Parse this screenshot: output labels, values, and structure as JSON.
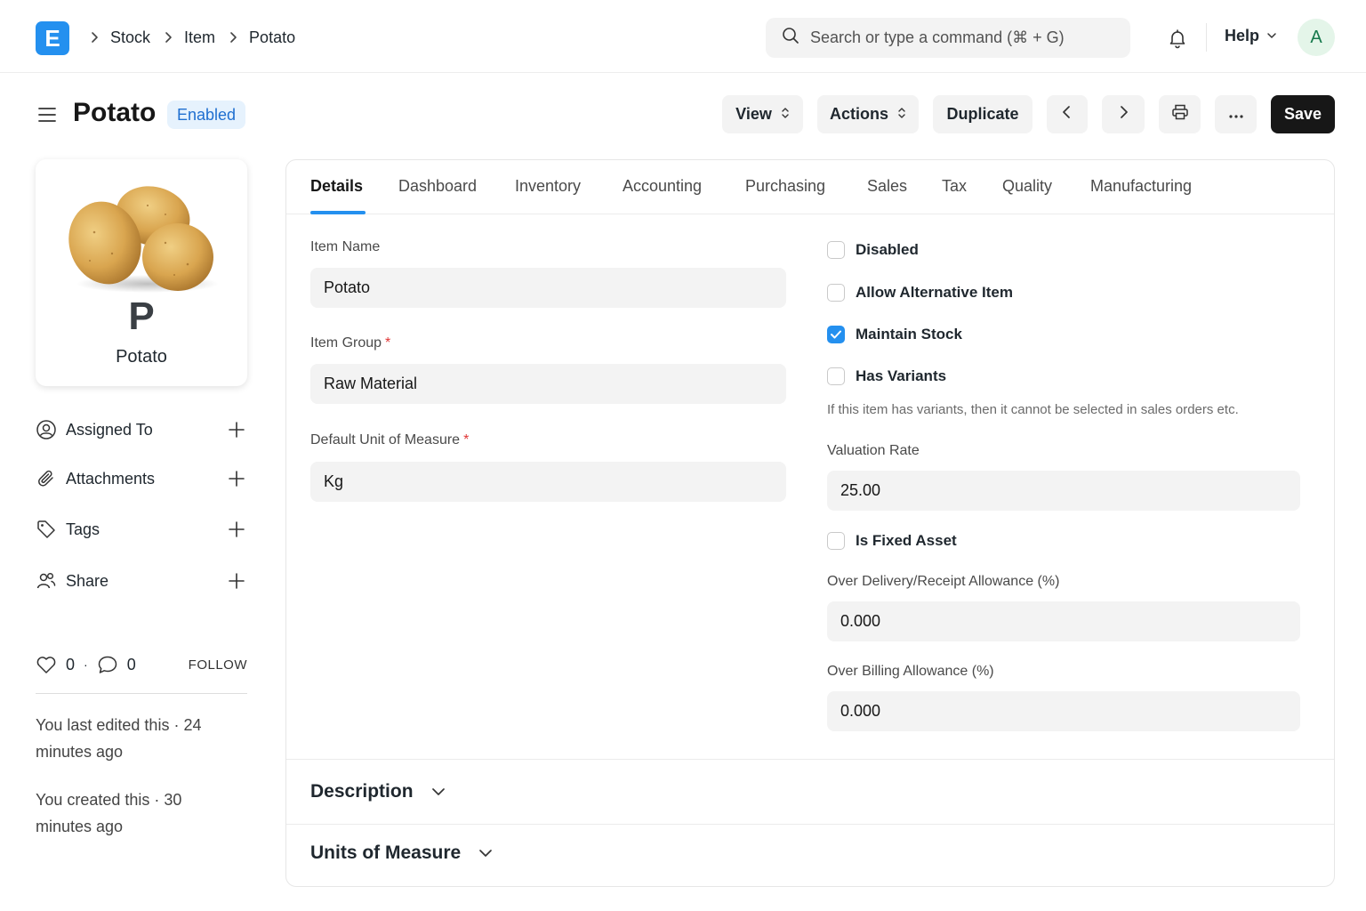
{
  "navbar": {
    "logo_letter": "E",
    "breadcrumbs": [
      "Stock",
      "Item",
      "Potato"
    ],
    "search_placeholder": "Search or type a command (⌘ + G)",
    "help_label": "Help",
    "avatar_initial": "A"
  },
  "page": {
    "title": "Potato",
    "status": "Enabled",
    "buttons": {
      "view": "View",
      "actions": "Actions",
      "duplicate": "Duplicate",
      "save": "Save"
    }
  },
  "sidebar": {
    "image_initial": "P",
    "image_name": "Potato",
    "items": [
      {
        "label": "Assigned To",
        "icon": "user-circle-icon"
      },
      {
        "label": "Attachments",
        "icon": "paperclip-icon"
      },
      {
        "label": "Tags",
        "icon": "tag-icon"
      },
      {
        "label": "Share",
        "icon": "share-users-icon"
      }
    ],
    "likes_count": "0",
    "comments_count": "0",
    "follow_label": "FOLLOW",
    "activity": [
      "You last edited this · 24 minutes ago",
      "You created this · 30 minutes ago"
    ]
  },
  "tabs": [
    "Details",
    "Dashboard",
    "Inventory",
    "Accounting",
    "Purchasing",
    "Sales",
    "Tax",
    "Quality",
    "Manufacturing"
  ],
  "active_tab": "Details",
  "form": {
    "item_name": {
      "label": "Item Name",
      "value": "Potato"
    },
    "item_group": {
      "label": "Item Group",
      "required": "*",
      "value": "Raw Material"
    },
    "uom": {
      "label": "Default Unit of Measure",
      "required": "*",
      "value": "Kg"
    },
    "checkboxes": [
      {
        "label": "Disabled",
        "checked": false
      },
      {
        "label": "Allow Alternative Item",
        "checked": false
      },
      {
        "label": "Maintain Stock",
        "checked": true
      },
      {
        "label": "Has Variants",
        "checked": false
      }
    ],
    "variants_help": "If this item has variants, then it cannot be selected in sales orders etc.",
    "valuation_rate": {
      "label": "Valuation Rate",
      "value": "25.00"
    },
    "fixed_asset": {
      "label": "Is Fixed Asset",
      "checked": false
    },
    "over_delivery": {
      "label": "Over Delivery/Receipt Allowance (%)",
      "value": "0.000"
    },
    "over_billing": {
      "label": "Over Billing Allowance (%)",
      "value": "0.000"
    }
  },
  "sections": [
    "Description",
    "Units of Measure"
  ],
  "colors": {
    "accent": "#2490ef",
    "save_button": "#171717",
    "required": "#e03636",
    "badge_bg": "#e6f2fd",
    "badge_text": "#1f6fd0"
  }
}
